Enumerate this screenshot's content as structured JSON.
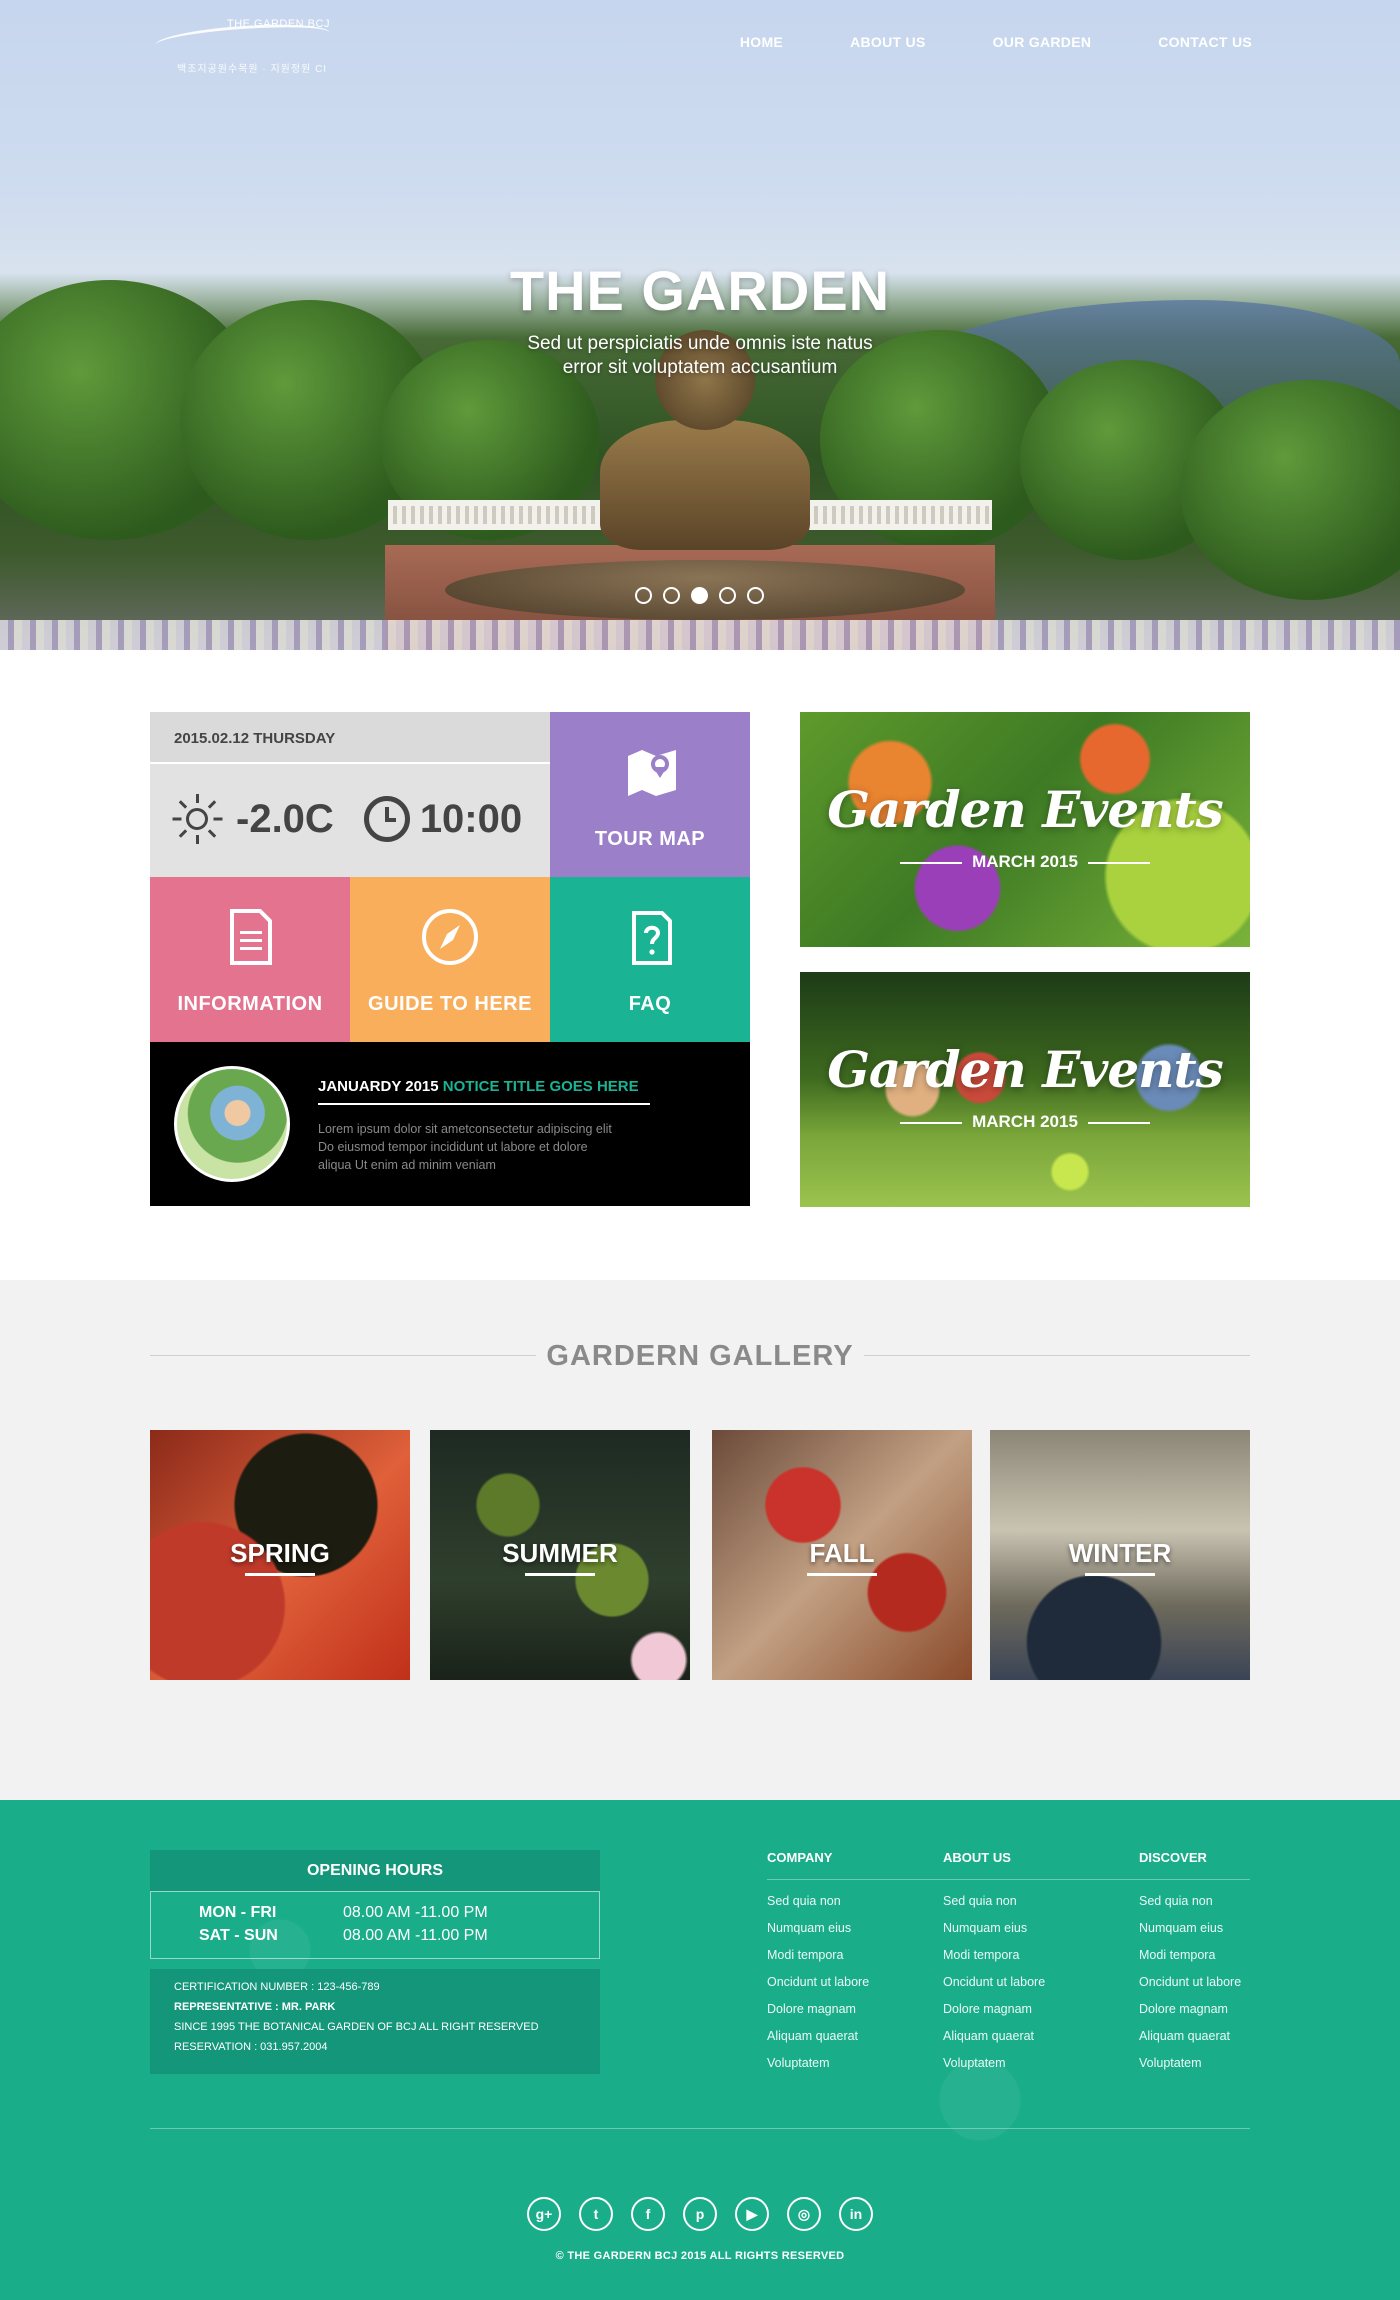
{
  "header": {
    "logo": {
      "brand": "THE GARDEN BCJ",
      "tagline": "백조지공원수목원 · 지원정원 CI"
    },
    "nav": [
      "HOME",
      "ABOUT US",
      "OUR GARDEN",
      "CONTACT US"
    ]
  },
  "hero": {
    "title": "THE GARDEN",
    "subtitle_line1": "Sed ut perspiciatis unde omnis iste natus",
    "subtitle_line2": "error sit voluptatem accusantium",
    "slides": {
      "count": 5,
      "active": 3
    }
  },
  "tiles": {
    "date": "2015.02.12 THURSDAY",
    "temperature": "-2.0C",
    "time": "10:00",
    "tour_map": "TOUR MAP",
    "information": "INFORMATION",
    "guide": "GUIDE TO HERE",
    "faq": "FAQ",
    "notice": {
      "date": "JANUARDY 2015",
      "title": "NOTICE TITLE GOES HERE",
      "body_line1": "Lorem ipsum dolor sit ametconsectetur adipiscing elit",
      "body_line2": "Do eiusmod tempor incididunt ut labore et dolore",
      "body_line3": "aliqua Ut enim ad minim veniam"
    }
  },
  "events": [
    {
      "title": "Garden Events",
      "date": "MARCH 2015"
    },
    {
      "title": "Garden Events",
      "date": "MARCH 2015"
    }
  ],
  "gallery": {
    "title": "GARDERN GALLERY",
    "seasons": [
      "SPRING",
      "SUMMER",
      "FALL",
      "WINTER"
    ]
  },
  "footer": {
    "hours": {
      "title": "OPENING HOURS",
      "rows": [
        {
          "days": "MON - FRI",
          "time": "08.00 AM -11.00 PM"
        },
        {
          "days": "SAT - SUN",
          "time": "08.00 AM -11.00 PM"
        }
      ],
      "cert": "CERTIFICATION NUMBER : 123-456-789",
      "rep": "REPRESENTATIVE : MR. PARK",
      "since": "SINCE 1995 THE BOTANICAL GARDEN OF BCJ ALL RIGHT RESERVED",
      "reservation": "RESERVATION : 031.957.2004"
    },
    "columns": [
      {
        "title": "COMPANY",
        "links": [
          "Sed quia non",
          "Numquam eius",
          "Modi tempora",
          "Oncidunt ut labore",
          "Dolore magnam",
          "Aliquam quaerat",
          "Voluptatem"
        ]
      },
      {
        "title": "ABOUT US",
        "links": [
          "Sed quia non",
          "Numquam eius",
          "Modi tempora",
          "Oncidunt ut labore",
          "Dolore magnam",
          "Aliquam quaerat",
          "Voluptatem"
        ]
      },
      {
        "title": "DISCOVER",
        "links": [
          "Sed quia non",
          "Numquam eius",
          "Modi tempora",
          "Oncidunt ut labore",
          "Dolore magnam",
          "Aliquam quaerat",
          "Voluptatem"
        ]
      }
    ],
    "social": [
      "google-plus-icon",
      "twitter-icon",
      "facebook-icon",
      "pinterest-icon",
      "youtube-icon",
      "dribbble-icon",
      "linkedin-icon"
    ],
    "copyright": "© THE GARDERN BCJ 2015 ALL RIGHTS RESERVED"
  },
  "colors": {
    "purple": "#9b7fc8",
    "pink": "#e3738f",
    "orange": "#f9ae5c",
    "teal": "#1ab394",
    "footer": "#1aad8a"
  }
}
